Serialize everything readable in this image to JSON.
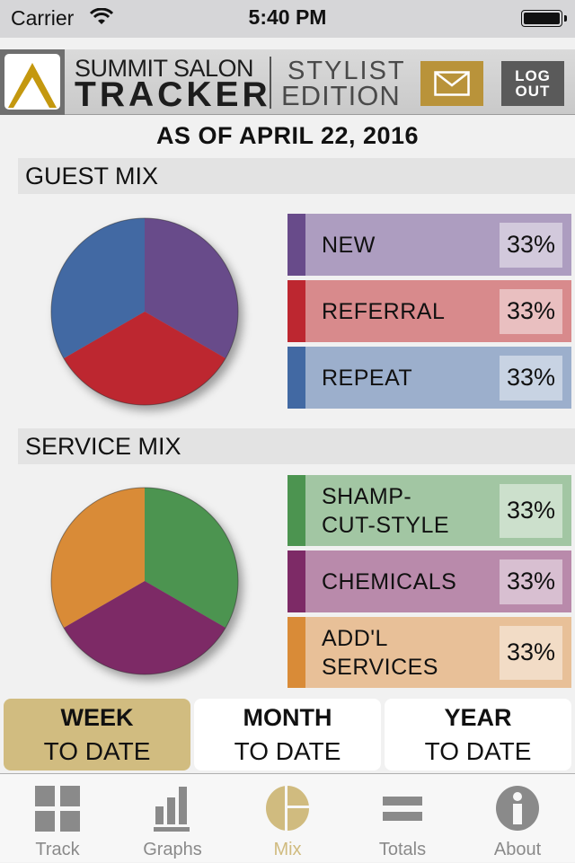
{
  "status_bar": {
    "carrier": "Carrier",
    "time": "5:40 PM",
    "battery_level": 1.0
  },
  "header": {
    "brand_line1": "SUMMIT SALON",
    "brand_line2": "TRACKER",
    "edition_line1": "STYLIST",
    "edition_line2": "EDITION",
    "mail_icon": "envelope-icon",
    "logout_line1": "LOG",
    "logout_line2": "OUT",
    "colors": {
      "logo_accent": "#c4980f",
      "mail_bg": "#b9933a",
      "logout_bg": "#5a5a5a"
    }
  },
  "as_of": "AS OF APRIL 22, 2016",
  "guest_mix": {
    "title": "GUEST MIX",
    "items": [
      {
        "label": "NEW",
        "value": 33,
        "display": "33%",
        "color": "#684b8a",
        "bg": "#ad9dc0"
      },
      {
        "label": "REFERRAL",
        "value": 33,
        "display": "33%",
        "color": "#bd2730",
        "bg": "#d88a8c"
      },
      {
        "label": "REPEAT",
        "value": 33,
        "display": "33%",
        "color": "#4269a3",
        "bg": "#9cafcc"
      }
    ]
  },
  "service_mix": {
    "title": "SERVICE MIX",
    "items": [
      {
        "label": "SHAMP-\nCUT-STYLE",
        "value": 33,
        "display": "33%",
        "color": "#4c9450",
        "bg": "#a2c6a3"
      },
      {
        "label": "CHEMICALS",
        "value": 33,
        "display": "33%",
        "color": "#7d2a66",
        "bg": "#b98aab"
      },
      {
        "label": "ADD'L\nSERVICES",
        "value": 33,
        "display": "33%",
        "color": "#d98b37",
        "bg": "#e8c098"
      }
    ]
  },
  "period_buttons": [
    {
      "line1": "WEEK",
      "line2": "TO DATE",
      "active": true
    },
    {
      "line1": "MONTH",
      "line2": "TO DATE",
      "active": false
    },
    {
      "line1": "YEAR",
      "line2": "TO DATE",
      "active": false
    }
  ],
  "tabs": [
    {
      "label": "Track",
      "icon": "grid-icon",
      "active": false
    },
    {
      "label": "Graphs",
      "icon": "bar-chart-icon",
      "active": false
    },
    {
      "label": "Mix",
      "icon": "pie-chart-icon",
      "active": true
    },
    {
      "label": "Totals",
      "icon": "equals-icon",
      "active": false
    },
    {
      "label": "About",
      "icon": "info-icon",
      "active": false
    }
  ],
  "colors": {
    "tab_active": "#d0bb7f",
    "tab_inactive": "#8a8a8a",
    "period_active": "#d1bc80"
  }
}
